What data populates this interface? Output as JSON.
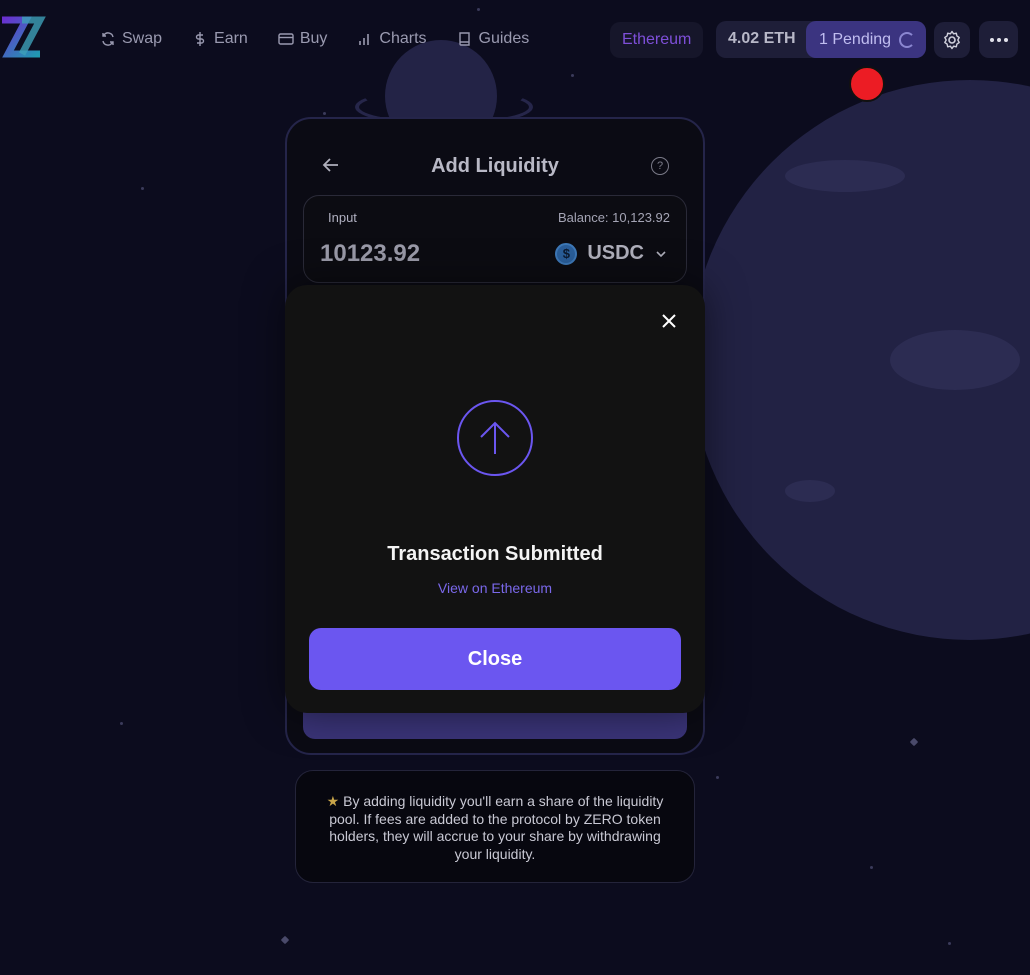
{
  "header": {
    "nav": [
      {
        "label": "Swap",
        "icon": "refresh-icon"
      },
      {
        "label": "Earn",
        "icon": "dollar-icon"
      },
      {
        "label": "Buy",
        "icon": "card-icon"
      },
      {
        "label": "Charts",
        "icon": "bar-chart-icon"
      },
      {
        "label": "Guides",
        "icon": "book-icon"
      }
    ],
    "network": "Ethereum",
    "balance": "4.02 ETH",
    "pending": "1 Pending"
  },
  "card": {
    "title": "Add Liquidity",
    "help": "?",
    "input_label": "Input",
    "balance": "Balance: 10,123.92",
    "amount": "10123.92",
    "token": "USDC",
    "token_icon_glyph": "$"
  },
  "modal": {
    "title": "Transaction Submitted",
    "link": "View on Ethereum",
    "close_label": "Close"
  },
  "info": {
    "star": "★",
    "text": "By adding liquidity you'll earn a share of the liquidity pool. If fees are added to the protocol by ZERO token holders, they will accrue to your share by withdrawing your liquidity."
  },
  "colors": {
    "accent": "#6b56f0",
    "network": "#7e4fd8",
    "record_dot": "#ec1c24"
  }
}
